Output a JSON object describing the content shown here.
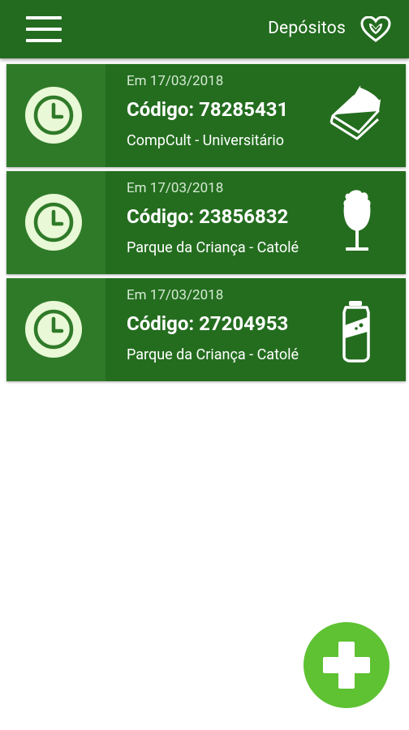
{
  "app_bar": {
    "title": "Depósitos",
    "menu_icon": "hamburger-menu-icon",
    "logo_icon": "heart-logo-icon",
    "color": "#236b1f"
  },
  "deposits": [
    {
      "date": "Em 17/03/2018",
      "code": "Código: 78285431",
      "location": "CompCult - Universitário",
      "status_icon": "clock-icon",
      "material_icon": "paper-icon"
    },
    {
      "date": "Em 17/03/2018",
      "code": "Código: 23856832",
      "location": "Parque da Criança - Catolé",
      "status_icon": "clock-icon",
      "material_icon": "glass-icon"
    },
    {
      "date": "Em 17/03/2018",
      "code": "Código: 27204953",
      "location": "Parque da Criança - Catolé",
      "status_icon": "clock-icon",
      "material_icon": "can-icon"
    }
  ],
  "fab": {
    "icon": "plus-icon",
    "color": "#5ec233"
  },
  "colors": {
    "card": "#246d1f",
    "card_left": "#2f7a29",
    "clock_face": "#e9f8d6"
  }
}
